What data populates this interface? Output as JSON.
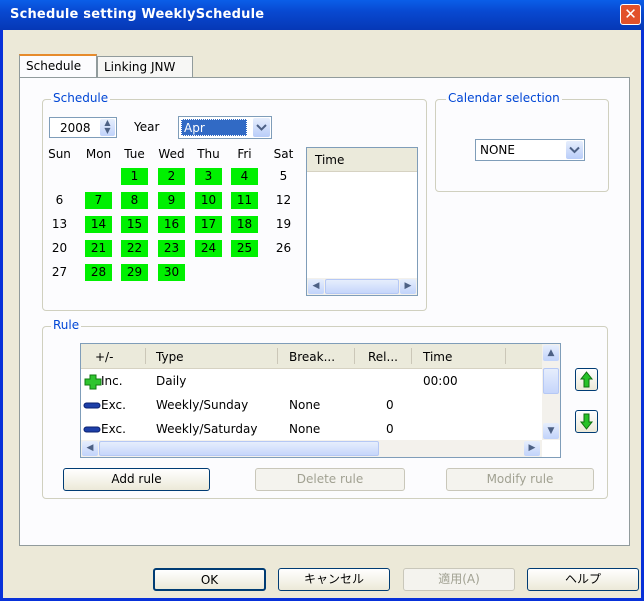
{
  "window": {
    "title": "Schedule setting WeeklySchedule",
    "close_glyph": "✕"
  },
  "tabs": [
    {
      "label": "Schedule"
    },
    {
      "label": "Linking JNW"
    }
  ],
  "schedule_group": {
    "legend": "Schedule",
    "year_value": "2008",
    "year_label": "Year",
    "month_value": "Apr",
    "weekday_headers": [
      "Sun",
      "Mon",
      "Tue",
      "Wed",
      "Thu",
      "Fri",
      "Sat"
    ],
    "weeks": [
      [
        {
          "d": "",
          "g": false
        },
        {
          "d": "",
          "g": false
        },
        {
          "d": "1",
          "g": true
        },
        {
          "d": "2",
          "g": true
        },
        {
          "d": "3",
          "g": true
        },
        {
          "d": "4",
          "g": true
        },
        {
          "d": "5",
          "g": false
        }
      ],
      [
        {
          "d": "6",
          "g": false
        },
        {
          "d": "7",
          "g": true
        },
        {
          "d": "8",
          "g": true
        },
        {
          "d": "9",
          "g": true
        },
        {
          "d": "10",
          "g": true
        },
        {
          "d": "11",
          "g": true
        },
        {
          "d": "12",
          "g": false
        }
      ],
      [
        {
          "d": "13",
          "g": false
        },
        {
          "d": "14",
          "g": true
        },
        {
          "d": "15",
          "g": true
        },
        {
          "d": "16",
          "g": true
        },
        {
          "d": "17",
          "g": true
        },
        {
          "d": "18",
          "g": true
        },
        {
          "d": "19",
          "g": false
        }
      ],
      [
        {
          "d": "20",
          "g": false
        },
        {
          "d": "21",
          "g": true
        },
        {
          "d": "22",
          "g": true
        },
        {
          "d": "23",
          "g": true
        },
        {
          "d": "24",
          "g": true
        },
        {
          "d": "25",
          "g": true
        },
        {
          "d": "26",
          "g": false
        }
      ],
      [
        {
          "d": "27",
          "g": false
        },
        {
          "d": "28",
          "g": true
        },
        {
          "d": "29",
          "g": true
        },
        {
          "d": "30",
          "g": true
        },
        {
          "d": "",
          "g": false
        },
        {
          "d": "",
          "g": false
        },
        {
          "d": "",
          "g": false
        }
      ]
    ],
    "time_list_header": "Time",
    "highlight_color": "#00f000"
  },
  "calendar_group": {
    "legend": "Calendar selection",
    "value": "NONE"
  },
  "rule_group": {
    "legend": "Rule",
    "columns": [
      "+/-",
      "Type",
      "Break...",
      "Rel...",
      "Time"
    ],
    "rows": [
      {
        "icon": "plus-icon",
        "sign": "Inc.",
        "type": "Daily",
        "break": "",
        "rel": "",
        "time": "00:00"
      },
      {
        "icon": "minus-icon",
        "sign": "Exc.",
        "type": "Weekly/Sunday",
        "break": "None",
        "rel": "0",
        "time": ""
      },
      {
        "icon": "minus-icon",
        "sign": "Exc.",
        "type": "Weekly/Saturday",
        "break": "None",
        "rel": "0",
        "time": ""
      }
    ],
    "add_label": "Add rule",
    "delete_label": "Delete rule",
    "modify_label": "Modify rule"
  },
  "footer": {
    "ok_label": "OK",
    "cancel_label": "キャンセル",
    "apply_label": "適用(A)",
    "help_label": "ヘルプ"
  }
}
